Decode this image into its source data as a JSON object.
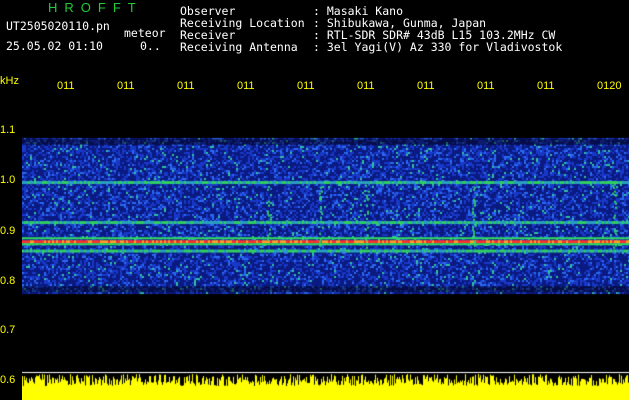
{
  "header": {
    "logo": "HROFFT",
    "filename": "UT2505020110.pn",
    "type_label": "meteor",
    "datetime": "25.05.02 01:10",
    "counter": "0..",
    "fields": [
      {
        "label": "Observer",
        "value": ": Masaki Kano"
      },
      {
        "label": "Receiving Location",
        "value": ": Shibukawa, Gunma, Japan"
      },
      {
        "label": "Receiver",
        "value": ": RTL-SDR SDR# 43dB L15 103.2MHz CW"
      },
      {
        "label": "Receiving Antenna",
        "value": ": 3el Yagi(V) Az 330 for Vladivostok"
      }
    ]
  },
  "axis": {
    "unit": "kHz",
    "y_ticks": [
      "1.1",
      "1.0",
      "0.9",
      "0.8",
      "0.7",
      "0.6"
    ],
    "x_ticks": [
      "011",
      "011",
      "011",
      "011",
      "011",
      "011",
      "011",
      "011",
      "011",
      "0120"
    ]
  },
  "spectrogram": {
    "y_range_khz": [
      0.6,
      1.12
    ],
    "strong_line_khz": 0.855,
    "secondary_lines_khz": [
      0.963,
      0.838,
      0.89
    ],
    "colors": {
      "background": "#000000",
      "noise": "#1030c0",
      "signal": "#30e060",
      "peak": "#ff3030",
      "bars": "#ffff00"
    }
  }
}
